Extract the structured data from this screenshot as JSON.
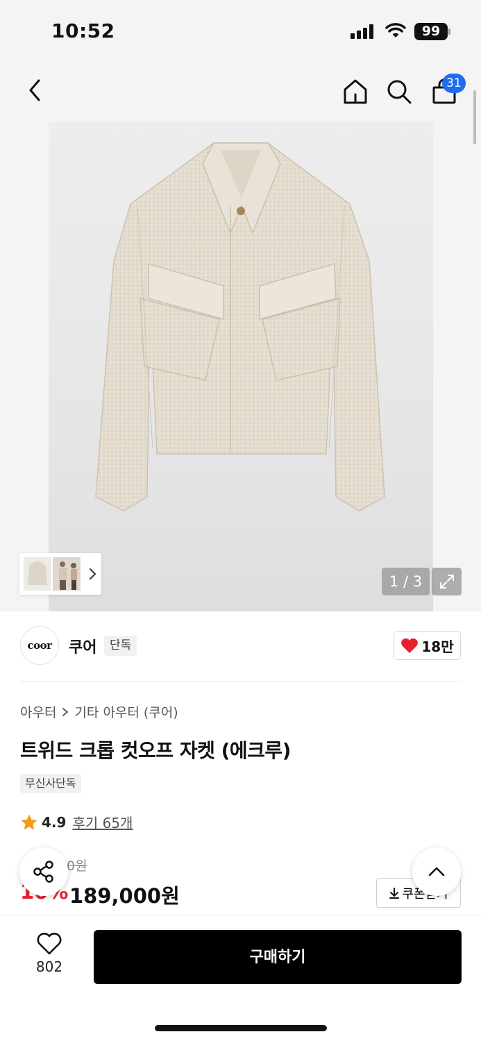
{
  "status_bar": {
    "time": "10:52",
    "battery": "99"
  },
  "nav": {
    "cart_count": "31"
  },
  "gallery": {
    "pager": "1 / 3"
  },
  "brand": {
    "logo_text": "coor",
    "name": "쿠어",
    "tag": "단독",
    "likes": "18만"
  },
  "breadcrumb": {
    "category": "아우터",
    "subcategory": "기타 아우터 (쿠어)"
  },
  "product": {
    "title": "트위드 크롭 컷오프 자켓 (에크루)",
    "store_tag": "무신사단독",
    "rating": "4.9",
    "reviews": "후기 65개",
    "original_price": "0원",
    "discount": "10%",
    "price": "189,000원",
    "coupon_label": "쿠폰받기"
  },
  "bottom_bar": {
    "wish_count": "802",
    "buy_label": "구매하기"
  },
  "colors": {
    "accent_blue": "#1e6cf3",
    "discount_red": "#e5212f",
    "heart_red": "#e5212f",
    "star": "#f39b1b",
    "buy_button": "#000000"
  }
}
